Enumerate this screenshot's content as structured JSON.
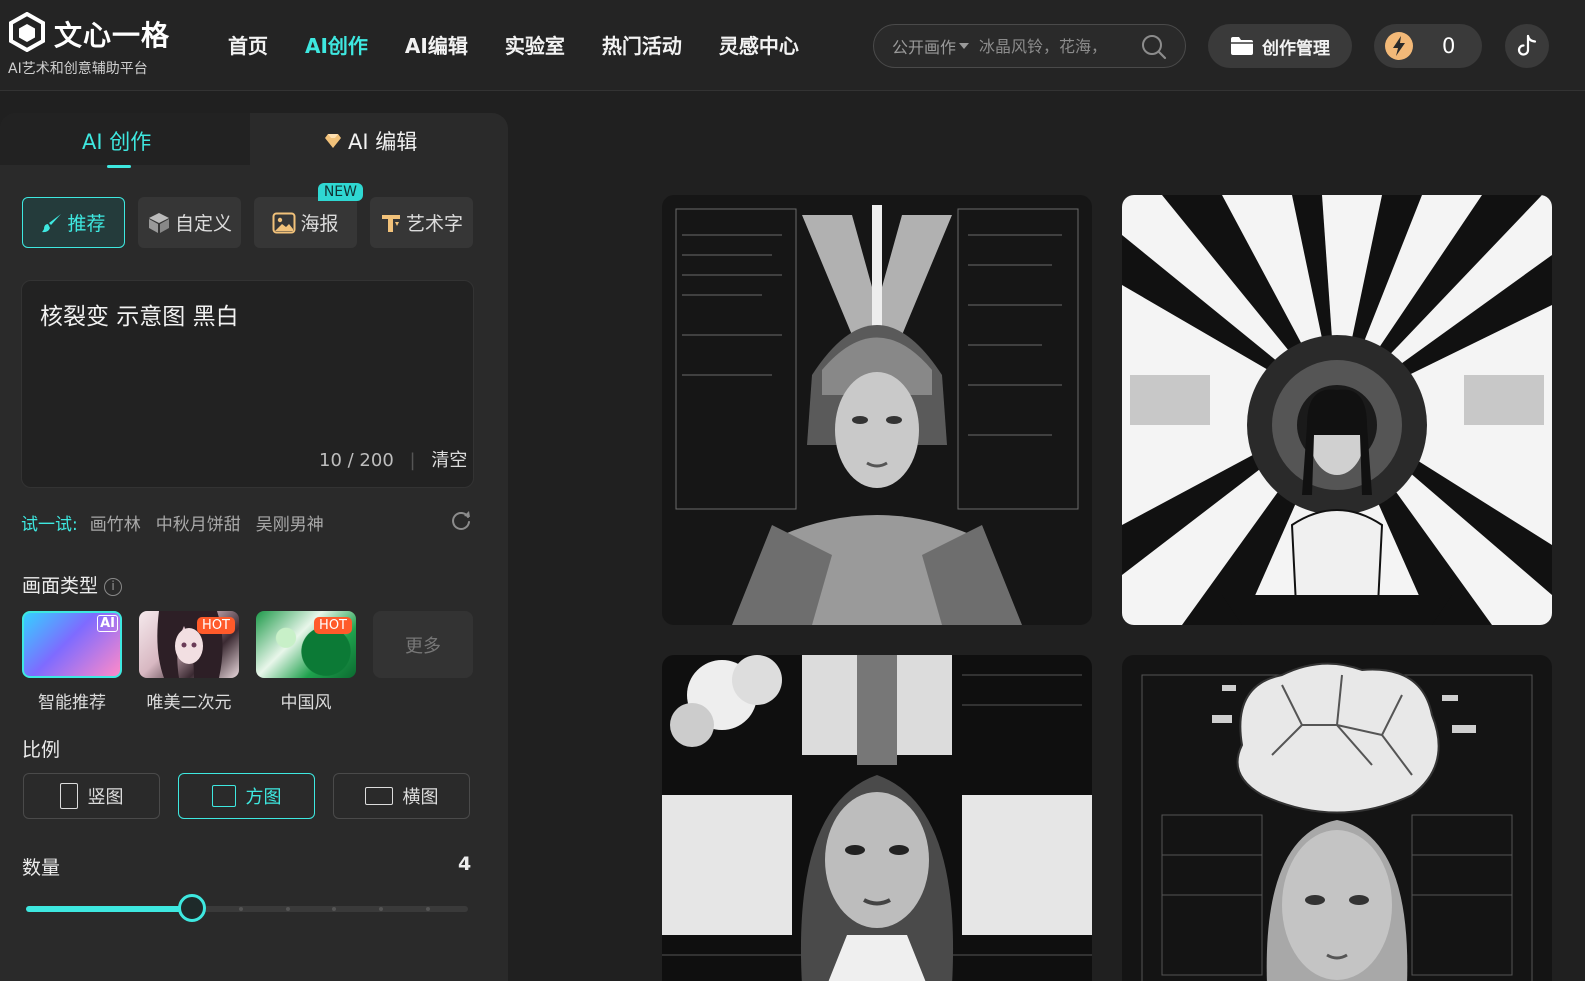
{
  "header": {
    "brand": "文心一格",
    "tagline": "AI艺术和创意辅助平台",
    "nav": [
      "首页",
      "AI创作",
      "AI编辑",
      "实验室",
      "热门活动",
      "灵感中心"
    ],
    "active_nav": "AI创作",
    "search": {
      "scope": "公开画作",
      "placeholder": "冰晶风铃，花海，"
    },
    "manage_label": "创作管理",
    "points": "0"
  },
  "panel": {
    "tabs": {
      "create": "AI 创作",
      "edit": "AI 编辑"
    },
    "modes": [
      {
        "label": "推荐",
        "icon": "brush-icon",
        "active": true
      },
      {
        "label": "自定义",
        "icon": "cube-icon"
      },
      {
        "label": "海报",
        "icon": "image-icon",
        "badge": "NEW"
      },
      {
        "label": "艺术字",
        "icon": "text-art-icon"
      }
    ],
    "prompt": {
      "value": "核裂变 示意图 黑白",
      "count": "10",
      "max": "/ 200",
      "clear": "清空"
    },
    "try": {
      "label": "试一试:",
      "items": [
        "画竹林",
        "中秋月饼甜",
        "吴刚男神"
      ]
    },
    "style_section": "画面类型",
    "styles": [
      {
        "name": "智能推荐",
        "badge": "AI"
      },
      {
        "name": "唯美二次元",
        "badge": "HOT"
      },
      {
        "name": "中国风",
        "badge": "HOT"
      }
    ],
    "more": "更多",
    "ratio_section": "比例",
    "ratios": [
      {
        "label": "竖图"
      },
      {
        "label": "方图",
        "active": true
      },
      {
        "label": "横图"
      }
    ],
    "quantity_section": "数量",
    "quantity": "4",
    "quantity_min": 1,
    "quantity_max": 9
  },
  "colors": {
    "accent": "#3ee8e0",
    "background": "#202020",
    "panel": "#2a2a2a"
  }
}
